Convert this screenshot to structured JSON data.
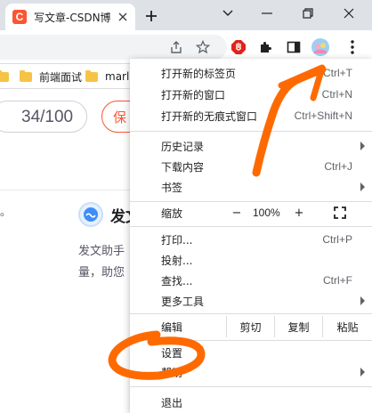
{
  "tab": {
    "favicon_letter": "C",
    "title": "写文章-CSDN博"
  },
  "bookmarks": {
    "items": [
      {
        "label": "前端面试"
      },
      {
        "label": "marl"
      }
    ]
  },
  "editor": {
    "word_counter": "34/100",
    "save_label": "保",
    "bullet": "。",
    "assistant_title": "发文",
    "assistant_desc_line1": "发文助手",
    "assistant_desc_line2": "量，助您"
  },
  "menu": {
    "new_tab": {
      "label": "打开新的标签页",
      "shortcut": "Ctrl+T"
    },
    "new_window": {
      "label": "打开新的窗口",
      "shortcut": "Ctrl+N"
    },
    "incognito": {
      "label": "打开新的无痕式窗口",
      "shortcut": "Ctrl+Shift+N"
    },
    "history": {
      "label": "历史记录"
    },
    "downloads": {
      "label": "下载内容",
      "shortcut": "Ctrl+J"
    },
    "bookmarks": {
      "label": "书签"
    },
    "zoom": {
      "label": "缩放",
      "minus": "−",
      "value": "100%",
      "plus": "+"
    },
    "print": {
      "label": "打印...",
      "shortcut": "Ctrl+P"
    },
    "cast": {
      "label": "投射..."
    },
    "find": {
      "label": "查找...",
      "shortcut": "Ctrl+F"
    },
    "more_tools": {
      "label": "更多工具"
    },
    "edit": {
      "label": "编辑",
      "cut": "剪切",
      "copy": "复制",
      "paste": "粘贴"
    },
    "settings": {
      "label": "设置"
    },
    "help": {
      "label": "帮助"
    },
    "exit": {
      "label": "退出"
    }
  },
  "colors": {
    "brand_red": "#fc5531",
    "annotation_orange": "#ff6a00",
    "tabstrip_bg": "#dee1e6"
  },
  "icons": {
    "favicon": "csdn-favicon-icon",
    "share": "share-icon",
    "star": "star-icon",
    "adblock": "adblock-extension-icon",
    "extensions": "puzzle-icon",
    "sidepanel": "side-panel-icon",
    "profile": "profile-avatar-icon",
    "menu": "kebab-menu-icon",
    "fullscreen": "fullscreen-icon"
  }
}
